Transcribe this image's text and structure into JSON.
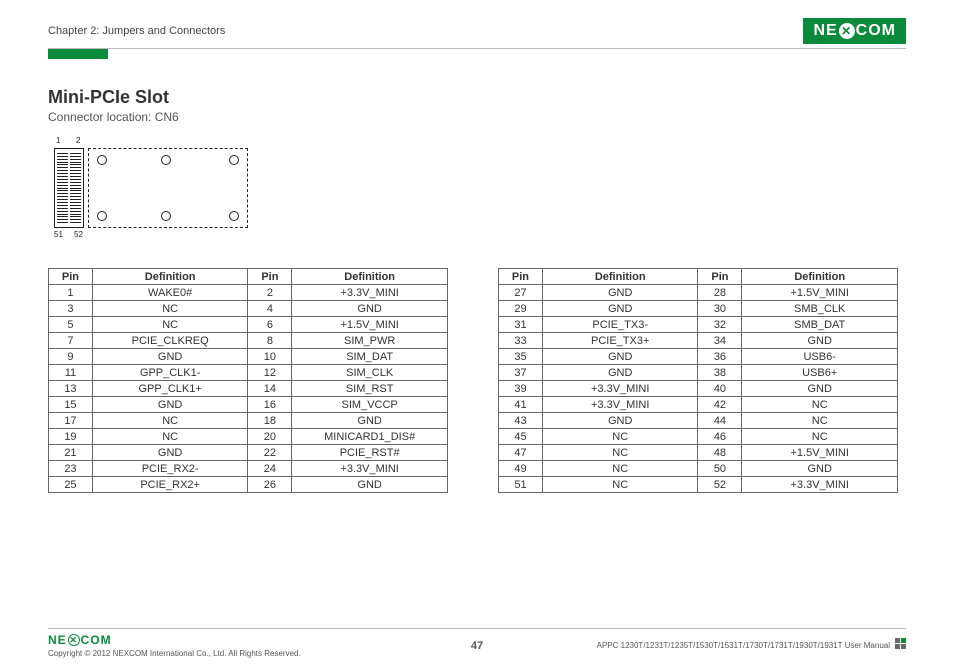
{
  "header": {
    "chapter": "Chapter 2: Jumpers and Connectors",
    "brand": "NEXCOM"
  },
  "section": {
    "title": "Mini-PCIe Slot",
    "subtitle": "Connector location: CN6"
  },
  "diagram": {
    "top_left_label": "1",
    "top_right_label": "2",
    "bottom_left_label": "51",
    "bottom_right_label": "52"
  },
  "table_headers": {
    "pin": "Pin",
    "definition": "Definition"
  },
  "left_table": [
    {
      "p1": "1",
      "d1": "WAKE0#",
      "p2": "2",
      "d2": "+3.3V_MINI"
    },
    {
      "p1": "3",
      "d1": "NC",
      "p2": "4",
      "d2": "GND"
    },
    {
      "p1": "5",
      "d1": "NC",
      "p2": "6",
      "d2": "+1.5V_MINI"
    },
    {
      "p1": "7",
      "d1": "PCIE_CLKREQ",
      "p2": "8",
      "d2": "SIM_PWR"
    },
    {
      "p1": "9",
      "d1": "GND",
      "p2": "10",
      "d2": "SIM_DAT"
    },
    {
      "p1": "11",
      "d1": "GPP_CLK1-",
      "p2": "12",
      "d2": "SIM_CLK"
    },
    {
      "p1": "13",
      "d1": "GPP_CLK1+",
      "p2": "14",
      "d2": "SIM_RST"
    },
    {
      "p1": "15",
      "d1": "GND",
      "p2": "16",
      "d2": "SIM_VCCP"
    },
    {
      "p1": "17",
      "d1": "NC",
      "p2": "18",
      "d2": "GND"
    },
    {
      "p1": "19",
      "d1": "NC",
      "p2": "20",
      "d2": "MINICARD1_DIS#"
    },
    {
      "p1": "21",
      "d1": "GND",
      "p2": "22",
      "d2": "PCIE_RST#"
    },
    {
      "p1": "23",
      "d1": "PCIE_RX2-",
      "p2": "24",
      "d2": "+3.3V_MINI"
    },
    {
      "p1": "25",
      "d1": "PCIE_RX2+",
      "p2": "26",
      "d2": "GND"
    }
  ],
  "right_table": [
    {
      "p1": "27",
      "d1": "GND",
      "p2": "28",
      "d2": "+1.5V_MINI"
    },
    {
      "p1": "29",
      "d1": "GND",
      "p2": "30",
      "d2": "SMB_CLK"
    },
    {
      "p1": "31",
      "d1": "PCIE_TX3-",
      "p2": "32",
      "d2": "SMB_DAT"
    },
    {
      "p1": "33",
      "d1": "PCIE_TX3+",
      "p2": "34",
      "d2": "GND"
    },
    {
      "p1": "35",
      "d1": "GND",
      "p2": "36",
      "d2": "USB6-"
    },
    {
      "p1": "37",
      "d1": "GND",
      "p2": "38",
      "d2": "USB6+"
    },
    {
      "p1": "39",
      "d1": "+3.3V_MINI",
      "p2": "40",
      "d2": "GND"
    },
    {
      "p1": "41",
      "d1": "+3.3V_MINI",
      "p2": "42",
      "d2": "NC"
    },
    {
      "p1": "43",
      "d1": "GND",
      "p2": "44",
      "d2": "NC"
    },
    {
      "p1": "45",
      "d1": "NC",
      "p2": "46",
      "d2": "NC"
    },
    {
      "p1": "47",
      "d1": "NC",
      "p2": "48",
      "d2": "+1.5V_MINI"
    },
    {
      "p1": "49",
      "d1": "NC",
      "p2": "50",
      "d2": "GND"
    },
    {
      "p1": "51",
      "d1": "NC",
      "p2": "52",
      "d2": "+3.3V_MINI"
    }
  ],
  "footer": {
    "copyright": "Copyright © 2012 NEXCOM International Co., Ltd. All Rights Reserved.",
    "page": "47",
    "manual": "APPC 1230T/1231T/1235T/1530T/1531T/1730T/1731T/1930T/1931T User Manual",
    "brand": "NEXCOM"
  }
}
